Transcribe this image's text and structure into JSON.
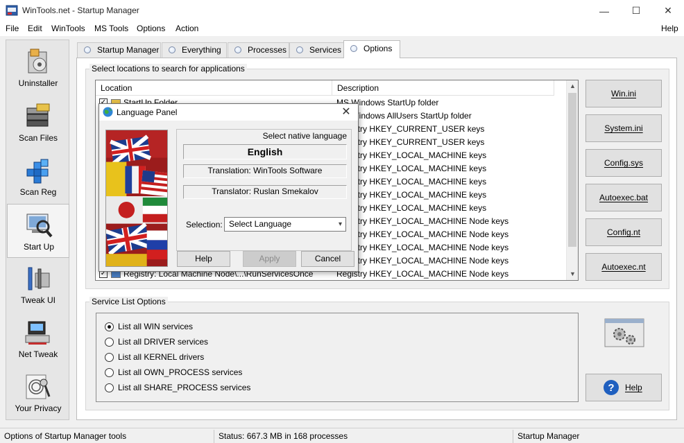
{
  "window": {
    "title": "WinTools.net - Startup Manager",
    "minimize_glyph": "—",
    "maximize_glyph": "☐",
    "close_glyph": "✕"
  },
  "menu": {
    "items": [
      "File",
      "Edit",
      "WinTools",
      "MS Tools",
      "Options",
      "Action"
    ],
    "help": "Help"
  },
  "sidebar": {
    "items": [
      {
        "label": "Uninstaller",
        "icon": "uninstaller-icon"
      },
      {
        "label": "Scan Files",
        "icon": "scan-files-icon"
      },
      {
        "label": "Scan Reg",
        "icon": "scan-reg-icon"
      },
      {
        "label": "Start Up",
        "icon": "start-up-icon",
        "active": true
      },
      {
        "label": "Tweak UI",
        "icon": "tweak-ui-icon"
      },
      {
        "label": "Net Tweak",
        "icon": "net-tweak-icon"
      },
      {
        "label": "Your Privacy",
        "icon": "your-privacy-icon"
      }
    ]
  },
  "tabs": [
    {
      "label": "Startup Manager"
    },
    {
      "label": "Everything"
    },
    {
      "label": "Processes"
    },
    {
      "label": "Services"
    },
    {
      "label": "Options",
      "active": true
    }
  ],
  "locations_group": {
    "title": "Select locations to search for applications",
    "columns": [
      "Location",
      "Description"
    ],
    "rows": [
      {
        "location": "StartUp Folder",
        "description": "MS Windows StartUp folder"
      },
      {
        "location": "",
        "description": "MS Windows AllUsers StartUp folder"
      },
      {
        "location": "",
        "description": "Registry HKEY_CURRENT_USER keys"
      },
      {
        "location": "",
        "description": "Registry HKEY_CURRENT_USER keys"
      },
      {
        "location": "",
        "description": "Registry HKEY_LOCAL_MACHINE keys"
      },
      {
        "location": "",
        "description": "Registry HKEY_LOCAL_MACHINE keys"
      },
      {
        "location": "",
        "description": "Registry HKEY_LOCAL_MACHINE keys"
      },
      {
        "location": "",
        "description": "Registry HKEY_LOCAL_MACHINE keys"
      },
      {
        "location": "",
        "description": "Registry HKEY_LOCAL_MACHINE keys"
      },
      {
        "location": "",
        "description": "Registry HKEY_LOCAL_MACHINE Node keys"
      },
      {
        "location": "",
        "description": "Registry HKEY_LOCAL_MACHINE Node keys"
      },
      {
        "location": "",
        "description": "Registry HKEY_LOCAL_MACHINE Node keys"
      },
      {
        "location": "",
        "description": "Registry HKEY_LOCAL_MACHINE Node keys"
      },
      {
        "location": "Registry: Local Machine Node\\...\\RunServicesOnce",
        "description": "Registry HKEY_LOCAL_MACHINE Node keys"
      }
    ],
    "buttons": [
      "Win.ini",
      "System.ini",
      "Config.sys",
      "Autoexec.bat",
      "Config.nt",
      "Autoexec.nt"
    ]
  },
  "service_group": {
    "title": "Service List Options",
    "options": [
      {
        "label": "List all WIN services",
        "checked": true
      },
      {
        "label": "List all DRIVER services",
        "checked": false
      },
      {
        "label": "List all KERNEL drivers",
        "checked": false
      },
      {
        "label": "List all OWN_PROCESS services",
        "checked": false
      },
      {
        "label": "List all SHARE_PROCESS services",
        "checked": false
      }
    ],
    "help_button": "Help"
  },
  "statusbar": {
    "left": "Options of Startup Manager tools",
    "middle": "Status: 667.3 MB in 168 processes",
    "right": "Startup Manager"
  },
  "dialog": {
    "title": "Language Panel",
    "native_label": "Select native language",
    "language": "English",
    "translation": "Translation: WinTools Software",
    "translator": "Translator: Ruslan Smekalov",
    "selection_label": "Selection:",
    "select_value": "Select Language",
    "buttons": {
      "help": "Help",
      "apply": "Apply",
      "cancel": "Cancel"
    }
  },
  "colors": {
    "accent": "#0078d7",
    "help_icon_bg": "#1f5fbf"
  }
}
